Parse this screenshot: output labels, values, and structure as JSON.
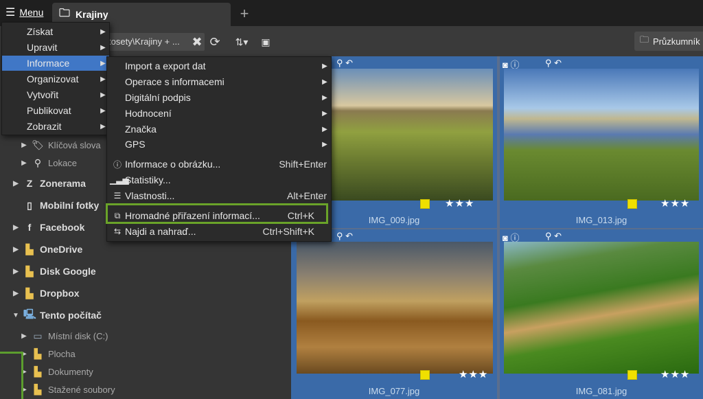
{
  "topbar": {
    "menu_label": "Menu",
    "tab_title": "Krajiny",
    "new_tab": "+"
  },
  "toolbar": {
    "path": "tosety\\Krajiny + ...",
    "explorer_label": "Průzkumník"
  },
  "sidebar": {
    "items": [
      {
        "label": "Klíčová slova",
        "icon": "tag-icon"
      },
      {
        "label": "Lokace",
        "icon": "location-icon"
      },
      {
        "label": "Zonerama",
        "icon": "zonerama-icon"
      },
      {
        "label": "Mobilní fotky",
        "icon": "phone-icon"
      },
      {
        "label": "Facebook",
        "icon": "facebook-icon"
      },
      {
        "label": "OneDrive",
        "icon": "onedrive-icon"
      },
      {
        "label": "Disk Google",
        "icon": "google-drive-icon"
      },
      {
        "label": "Dropbox",
        "icon": "dropbox-icon"
      },
      {
        "label": "Tento počítač",
        "icon": "computer-icon"
      },
      {
        "label": "Místní disk (C:)",
        "icon": "disk-icon"
      },
      {
        "label": "Plocha",
        "icon": "folder-icon"
      },
      {
        "label": "Dokumenty",
        "icon": "folder-icon"
      },
      {
        "label": "Stažené soubory",
        "icon": "folder-icon"
      }
    ]
  },
  "main_menu": {
    "items": [
      {
        "label": "Získat"
      },
      {
        "label": "Upravit"
      },
      {
        "label": "Informace"
      },
      {
        "label": "Organizovat"
      },
      {
        "label": "Vytvořit"
      },
      {
        "label": "Publikovat"
      },
      {
        "label": "Zobrazit"
      }
    ]
  },
  "info_menu": {
    "items": [
      {
        "label": "Import a export dat",
        "shortcut": ""
      },
      {
        "label": "Operace s informacemi",
        "shortcut": ""
      },
      {
        "label": "Digitální podpis",
        "shortcut": ""
      },
      {
        "label": "Hodnocení",
        "shortcut": ""
      },
      {
        "label": "Značka",
        "shortcut": ""
      },
      {
        "label": "GPS",
        "shortcut": ""
      },
      {
        "label": "Informace o obrázku...",
        "shortcut": "Shift+Enter"
      },
      {
        "label": "Statistiky...",
        "shortcut": ""
      },
      {
        "label": "Vlastnosti...",
        "shortcut": "Alt+Enter"
      },
      {
        "label": "Hromadné přiřazení informací...",
        "shortcut": "Ctrl+K"
      },
      {
        "label": "Najdi a nahraď...",
        "shortcut": "Ctrl+Shift+K"
      }
    ]
  },
  "thumbnails": [
    {
      "file": "IMG_009.jpg",
      "rating": "★★★"
    },
    {
      "file": "IMG_013.jpg",
      "rating": "★★★"
    },
    {
      "file": "IMG_077.jpg",
      "rating": "★★★"
    },
    {
      "file": "IMG_081.jpg",
      "rating": "★★★"
    }
  ],
  "colors": {
    "accent": "#4077c6",
    "highlight": "#6aa329",
    "flag": "#f0e000"
  }
}
